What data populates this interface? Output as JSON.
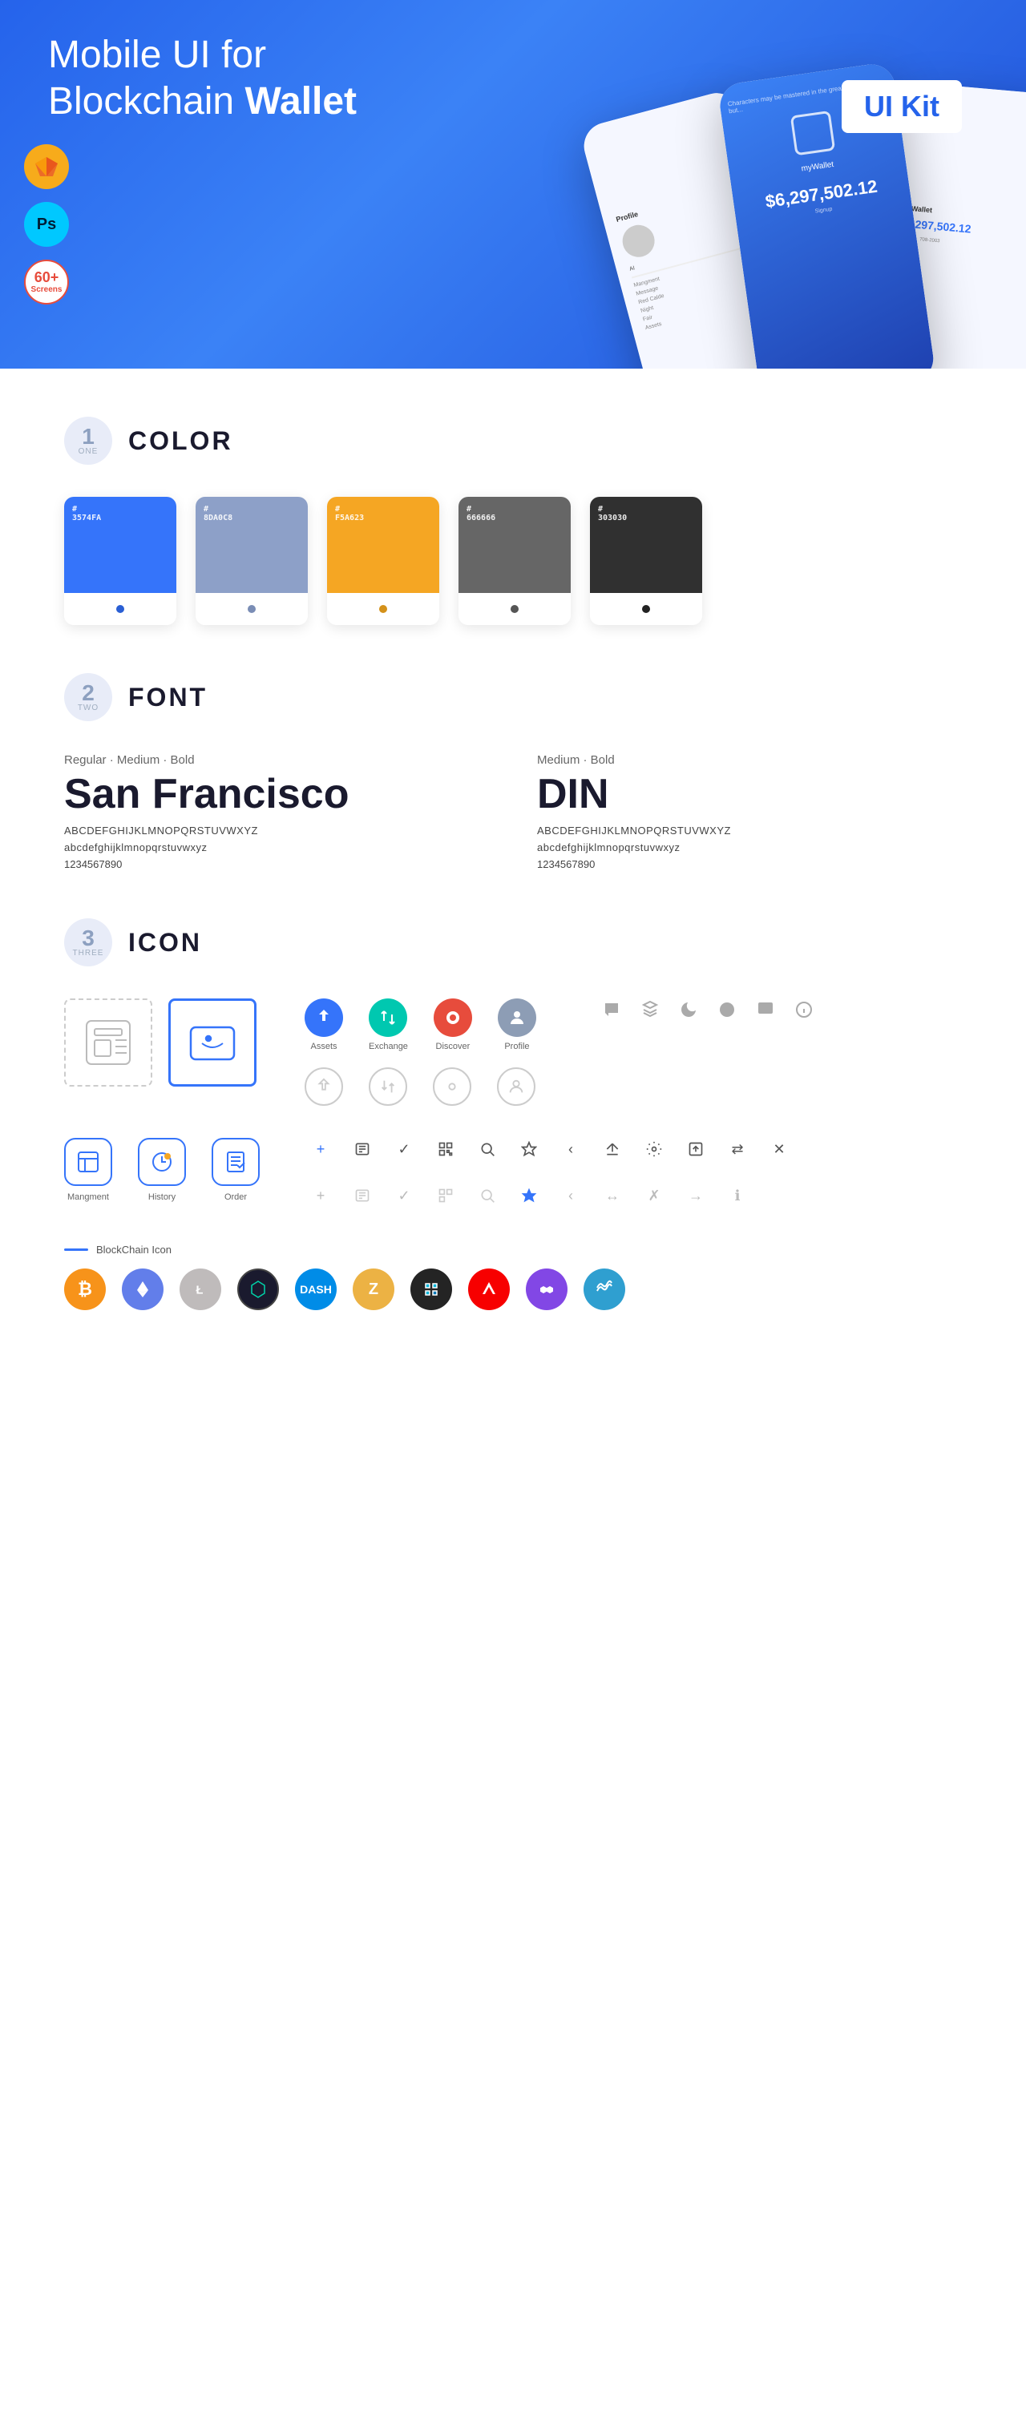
{
  "hero": {
    "title_regular": "Mobile UI for Blockchain ",
    "title_bold": "Wallet",
    "badge": "UI Kit",
    "sketch_label": "Sketch",
    "ps_label": "Ps",
    "screens_number": "60+",
    "screens_label": "Screens"
  },
  "section1": {
    "number": "1",
    "sub": "ONE",
    "title": "COLOR",
    "colors": [
      {
        "hex": "#3574FA",
        "code": "#3574FA",
        "dot": "#2A5FD4"
      },
      {
        "hex": "#8D A0C8",
        "code": "#8DA0C8",
        "dot": "#7A8DB5"
      },
      {
        "hex": "#F5A623",
        "code": "#F5A623",
        "dot": "#D4911A"
      },
      {
        "hex": "#666666",
        "code": "#666666",
        "dot": "#555555"
      },
      {
        "hex": "#303030",
        "code": "#303030",
        "dot": "#222222"
      }
    ]
  },
  "section2": {
    "number": "2",
    "sub": "TWO",
    "title": "FONT",
    "font1": {
      "style_label": "Regular · Medium · Bold",
      "name": "San Francisco",
      "uppercase": "ABCDEFGHIJKLMNOPQRSTUVWXYZ",
      "lowercase": "abcdefghijklmnopqrstuvwxyz",
      "numbers": "1234567890"
    },
    "font2": {
      "style_label": "Medium · Bold",
      "name": "DIN",
      "uppercase": "ABCDEFGHIJKLMNOPQRSTUVWXYZ",
      "lowercase": "abcdefghijklmnopqrstuvwxyz",
      "numbers": "1234567890"
    }
  },
  "section3": {
    "number": "3",
    "sub": "THREE",
    "title": "ICON",
    "nav_icons": [
      {
        "label": "Assets",
        "type": "diamond"
      },
      {
        "label": "Exchange",
        "type": "exchange"
      },
      {
        "label": "Discover",
        "type": "discover"
      },
      {
        "label": "Profile",
        "type": "profile"
      }
    ],
    "app_icons": [
      {
        "label": "Mangment",
        "icon": "⬛"
      },
      {
        "label": "History",
        "icon": "🕐"
      },
      {
        "label": "Order",
        "icon": "📋"
      }
    ],
    "blockchain_label": "BlockChain Icon",
    "crypto_icons": [
      {
        "symbol": "₿",
        "name": "Bitcoin",
        "class": "ci-btc"
      },
      {
        "symbol": "Ξ",
        "name": "Ethereum",
        "class": "ci-eth"
      },
      {
        "symbol": "Ł",
        "name": "Litecoin",
        "class": "ci-ltc"
      },
      {
        "symbol": "◈",
        "name": "BTG",
        "class": "ci-btg"
      },
      {
        "symbol": "D",
        "name": "Dash",
        "class": "ci-dash"
      },
      {
        "symbol": "Z",
        "name": "Zcash",
        "class": "ci-zcash"
      },
      {
        "symbol": "✦",
        "name": "IOTA",
        "class": "ci-iota"
      },
      {
        "symbol": "▲",
        "name": "Ark",
        "class": "ci-ark"
      },
      {
        "symbol": "⬡",
        "name": "Matic",
        "class": "ci-matic"
      },
      {
        "symbol": "~",
        "name": "Waves",
        "class": "ci-waves"
      }
    ]
  }
}
